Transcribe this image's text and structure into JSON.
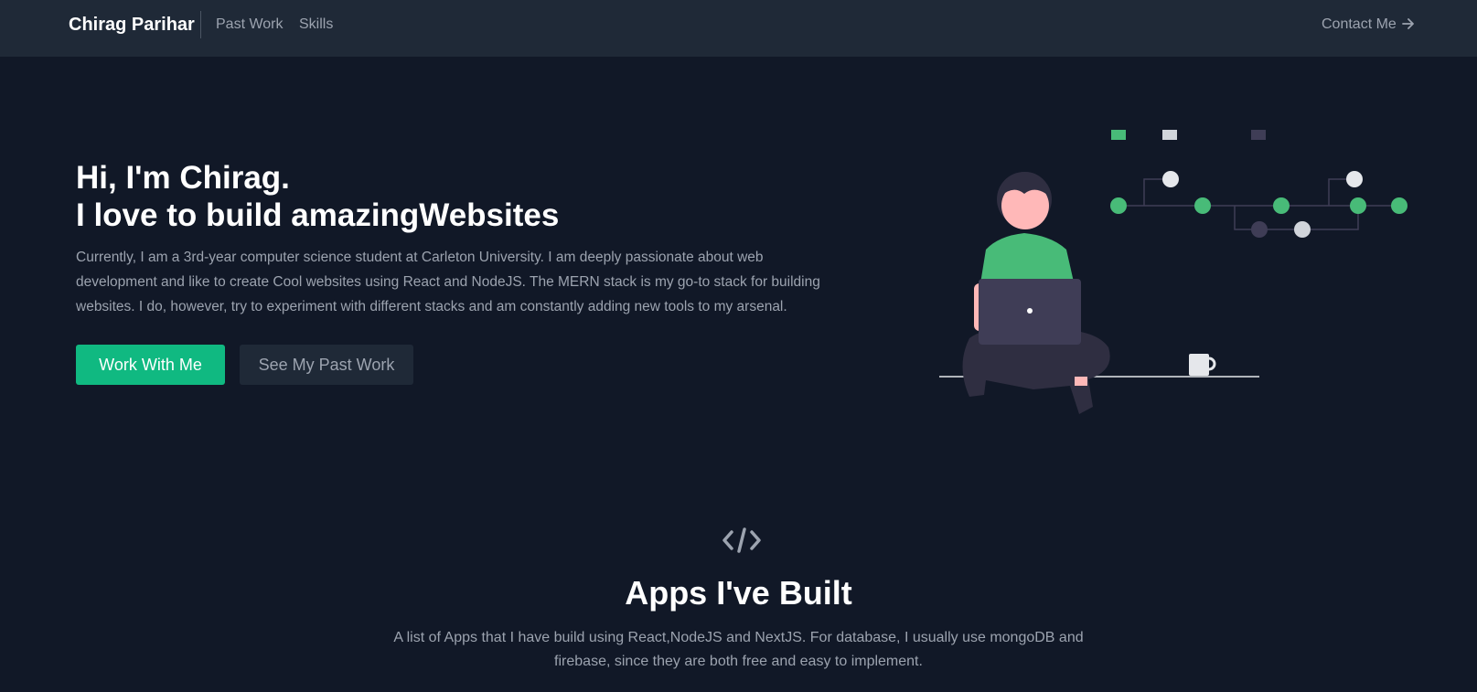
{
  "nav": {
    "brand": "Chirag Parihar",
    "links": [
      "Past Work",
      "Skills"
    ],
    "contact_label": "Contact Me",
    "contact_icon": "arrow-right-icon"
  },
  "hero": {
    "title_line1": "Hi, I'm Chirag.",
    "title_line2": "I love to build amazingWebsites",
    "description": "Currently, I am a 3rd-year computer science student at Carleton University. I am deeply passionate about web development and like to create Cool websites using React and NodeJS. The MERN stack is my go-to stack for building websites. I do, however, try to experiment with different stacks and am constantly adding new tools to my arsenal.",
    "primary_button": "Work With Me",
    "secondary_button": "See My Past Work",
    "illustration": "person-with-laptop-illustration"
  },
  "apps_section": {
    "icon": "code-icon",
    "title": "Apps I've Built",
    "description": "A list of Apps that I have build using React,NodeJS and NextJS. For database, I usually use mongoDB and firebase, since they are both free and easy to implement."
  },
  "colors": {
    "background": "#111827",
    "navbar": "#1f2937",
    "accent": "#10b981",
    "text_muted": "#9ca3af"
  }
}
